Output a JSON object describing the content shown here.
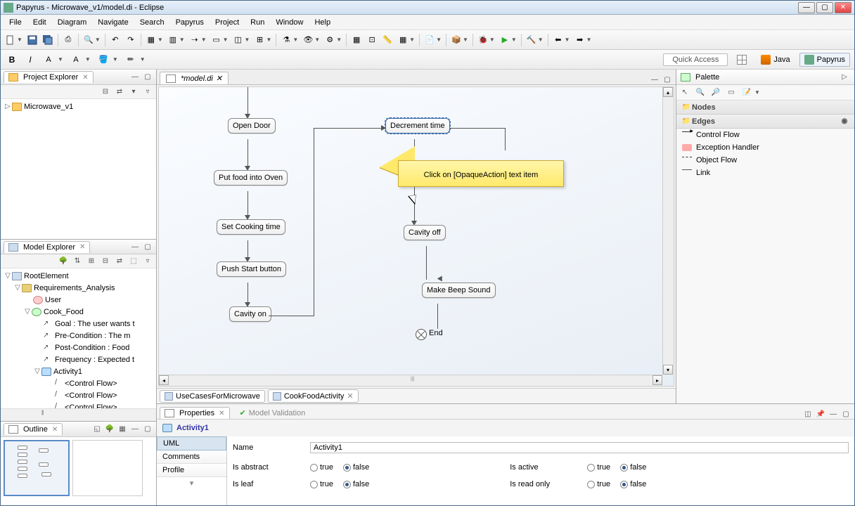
{
  "window": {
    "title": "Papyrus - Microwave_v1/model.di - Eclipse"
  },
  "menu": [
    "File",
    "Edit",
    "Diagram",
    "Navigate",
    "Search",
    "Papyrus",
    "Project",
    "Run",
    "Window",
    "Help"
  ],
  "quick_access": "Quick Access",
  "perspectives": {
    "java": "Java",
    "papyrus": "Papyrus"
  },
  "project_explorer": {
    "title": "Project Explorer",
    "items": [
      "Microwave_v1"
    ]
  },
  "model_explorer": {
    "title": "Model Explorer",
    "root": "RootElement",
    "req": "Requirements_Analysis",
    "user": "User",
    "cook": "Cook_Food",
    "goal": "Goal : The user wants t",
    "pre": "Pre-Condition : The m",
    "post": "Post-Condition : Food",
    "freq": "Frequency : Expected t",
    "activity": "Activity1",
    "flow": "<Control Flow>"
  },
  "outline": {
    "title": "Outline"
  },
  "editor": {
    "tab": "*model.di"
  },
  "diagram_tabs": {
    "usecase": "UseCasesForMicrowave",
    "cook": "CookFoodActivity"
  },
  "nodes": {
    "open_door": "Open Door",
    "put_food": "Put food into Oven",
    "set_time": "Set Cooking time",
    "push_start": "Push Start button",
    "cavity_on": "Cavity on",
    "decrement": "Decrement time",
    "cavity_off": "Cavity off",
    "beep": "Make Beep Sound",
    "end": "End"
  },
  "tooltip": "Click on [OpaqueAction] text item",
  "palette": {
    "title": "Palette",
    "nodes_section": "Nodes",
    "edges_section": "Edges",
    "items": {
      "control_flow": "Control Flow",
      "exception": "Exception Handler",
      "object_flow": "Object Flow",
      "link": "Link"
    }
  },
  "props": {
    "tab_properties": "Properties",
    "tab_validation": "Model Validation",
    "header": "Activity1",
    "side": {
      "uml": "UML",
      "comments": "Comments",
      "profile": "Profile"
    },
    "name_label": "Name",
    "name_value": "Activity1",
    "abstract_label": "Is abstract",
    "leaf_label": "Is leaf",
    "active_label": "Is active",
    "readonly_label": "Is read only",
    "true": "true",
    "false": "false"
  }
}
